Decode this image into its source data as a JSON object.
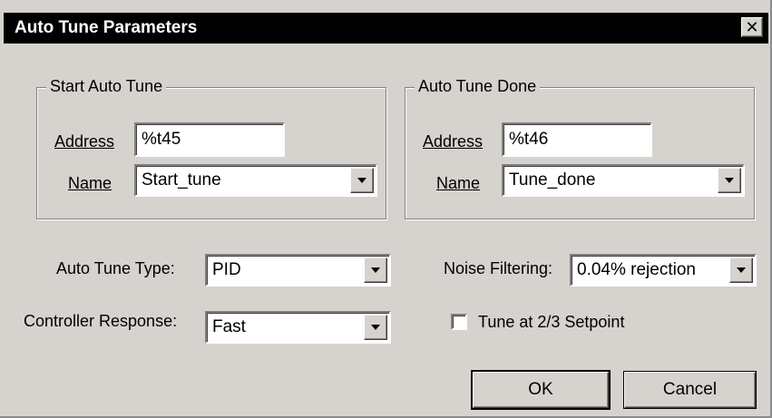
{
  "window": {
    "title": "Auto Tune Parameters",
    "close_icon": "close-icon"
  },
  "start_group": {
    "legend": "Start Auto Tune",
    "address_label": "Address",
    "address_value": "%t45",
    "name_label": "Name",
    "name_value": "Start_tune"
  },
  "done_group": {
    "legend": "Auto Tune Done",
    "address_label": "Address",
    "address_value": "%t46",
    "name_label": "Name",
    "name_value": "Tune_done"
  },
  "auto_tune_type": {
    "label": "Auto Tune Type:",
    "value": "PID"
  },
  "controller_response": {
    "label": "Controller Response:",
    "value": "Fast"
  },
  "noise_filtering": {
    "label": "Noise Filtering:",
    "value": "0.04% rejection"
  },
  "tune_setpoint": {
    "label": "Tune at 2/3 Setpoint",
    "checked": false
  },
  "buttons": {
    "ok": "OK",
    "cancel": "Cancel"
  },
  "colors": {
    "face": "#d6d3ce",
    "titlebar": "#000000",
    "title_text": "#ffffff"
  }
}
